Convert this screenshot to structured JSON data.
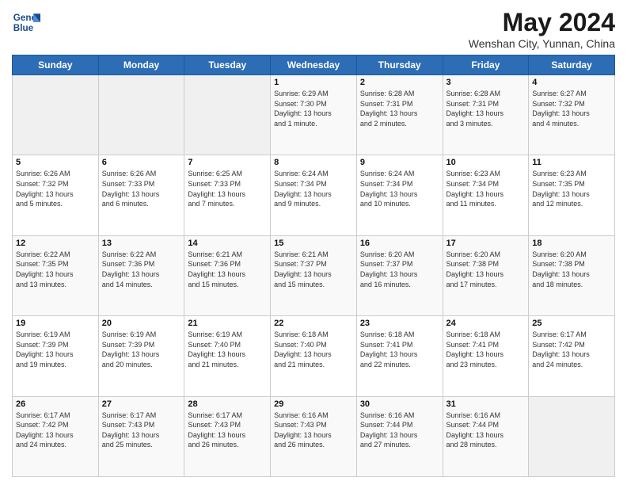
{
  "header": {
    "logo_line1": "General",
    "logo_line2": "Blue",
    "main_title": "May 2024",
    "subtitle": "Wenshan City, Yunnan, China"
  },
  "days_of_week": [
    "Sunday",
    "Monday",
    "Tuesday",
    "Wednesday",
    "Thursday",
    "Friday",
    "Saturday"
  ],
  "weeks": [
    [
      {
        "day": "",
        "info": ""
      },
      {
        "day": "",
        "info": ""
      },
      {
        "day": "",
        "info": ""
      },
      {
        "day": "1",
        "info": "Sunrise: 6:29 AM\nSunset: 7:30 PM\nDaylight: 13 hours\nand 1 minute."
      },
      {
        "day": "2",
        "info": "Sunrise: 6:28 AM\nSunset: 7:31 PM\nDaylight: 13 hours\nand 2 minutes."
      },
      {
        "day": "3",
        "info": "Sunrise: 6:28 AM\nSunset: 7:31 PM\nDaylight: 13 hours\nand 3 minutes."
      },
      {
        "day": "4",
        "info": "Sunrise: 6:27 AM\nSunset: 7:32 PM\nDaylight: 13 hours\nand 4 minutes."
      }
    ],
    [
      {
        "day": "5",
        "info": "Sunrise: 6:26 AM\nSunset: 7:32 PM\nDaylight: 13 hours\nand 5 minutes."
      },
      {
        "day": "6",
        "info": "Sunrise: 6:26 AM\nSunset: 7:33 PM\nDaylight: 13 hours\nand 6 minutes."
      },
      {
        "day": "7",
        "info": "Sunrise: 6:25 AM\nSunset: 7:33 PM\nDaylight: 13 hours\nand 7 minutes."
      },
      {
        "day": "8",
        "info": "Sunrise: 6:24 AM\nSunset: 7:34 PM\nDaylight: 13 hours\nand 9 minutes."
      },
      {
        "day": "9",
        "info": "Sunrise: 6:24 AM\nSunset: 7:34 PM\nDaylight: 13 hours\nand 10 minutes."
      },
      {
        "day": "10",
        "info": "Sunrise: 6:23 AM\nSunset: 7:34 PM\nDaylight: 13 hours\nand 11 minutes."
      },
      {
        "day": "11",
        "info": "Sunrise: 6:23 AM\nSunset: 7:35 PM\nDaylight: 13 hours\nand 12 minutes."
      }
    ],
    [
      {
        "day": "12",
        "info": "Sunrise: 6:22 AM\nSunset: 7:35 PM\nDaylight: 13 hours\nand 13 minutes."
      },
      {
        "day": "13",
        "info": "Sunrise: 6:22 AM\nSunset: 7:36 PM\nDaylight: 13 hours\nand 14 minutes."
      },
      {
        "day": "14",
        "info": "Sunrise: 6:21 AM\nSunset: 7:36 PM\nDaylight: 13 hours\nand 15 minutes."
      },
      {
        "day": "15",
        "info": "Sunrise: 6:21 AM\nSunset: 7:37 PM\nDaylight: 13 hours\nand 15 minutes."
      },
      {
        "day": "16",
        "info": "Sunrise: 6:20 AM\nSunset: 7:37 PM\nDaylight: 13 hours\nand 16 minutes."
      },
      {
        "day": "17",
        "info": "Sunrise: 6:20 AM\nSunset: 7:38 PM\nDaylight: 13 hours\nand 17 minutes."
      },
      {
        "day": "18",
        "info": "Sunrise: 6:20 AM\nSunset: 7:38 PM\nDaylight: 13 hours\nand 18 minutes."
      }
    ],
    [
      {
        "day": "19",
        "info": "Sunrise: 6:19 AM\nSunset: 7:39 PM\nDaylight: 13 hours\nand 19 minutes."
      },
      {
        "day": "20",
        "info": "Sunrise: 6:19 AM\nSunset: 7:39 PM\nDaylight: 13 hours\nand 20 minutes."
      },
      {
        "day": "21",
        "info": "Sunrise: 6:19 AM\nSunset: 7:40 PM\nDaylight: 13 hours\nand 21 minutes."
      },
      {
        "day": "22",
        "info": "Sunrise: 6:18 AM\nSunset: 7:40 PM\nDaylight: 13 hours\nand 21 minutes."
      },
      {
        "day": "23",
        "info": "Sunrise: 6:18 AM\nSunset: 7:41 PM\nDaylight: 13 hours\nand 22 minutes."
      },
      {
        "day": "24",
        "info": "Sunrise: 6:18 AM\nSunset: 7:41 PM\nDaylight: 13 hours\nand 23 minutes."
      },
      {
        "day": "25",
        "info": "Sunrise: 6:17 AM\nSunset: 7:42 PM\nDaylight: 13 hours\nand 24 minutes."
      }
    ],
    [
      {
        "day": "26",
        "info": "Sunrise: 6:17 AM\nSunset: 7:42 PM\nDaylight: 13 hours\nand 24 minutes."
      },
      {
        "day": "27",
        "info": "Sunrise: 6:17 AM\nSunset: 7:43 PM\nDaylight: 13 hours\nand 25 minutes."
      },
      {
        "day": "28",
        "info": "Sunrise: 6:17 AM\nSunset: 7:43 PM\nDaylight: 13 hours\nand 26 minutes."
      },
      {
        "day": "29",
        "info": "Sunrise: 6:16 AM\nSunset: 7:43 PM\nDaylight: 13 hours\nand 26 minutes."
      },
      {
        "day": "30",
        "info": "Sunrise: 6:16 AM\nSunset: 7:44 PM\nDaylight: 13 hours\nand 27 minutes."
      },
      {
        "day": "31",
        "info": "Sunrise: 6:16 AM\nSunset: 7:44 PM\nDaylight: 13 hours\nand 28 minutes."
      },
      {
        "day": "",
        "info": ""
      }
    ]
  ]
}
